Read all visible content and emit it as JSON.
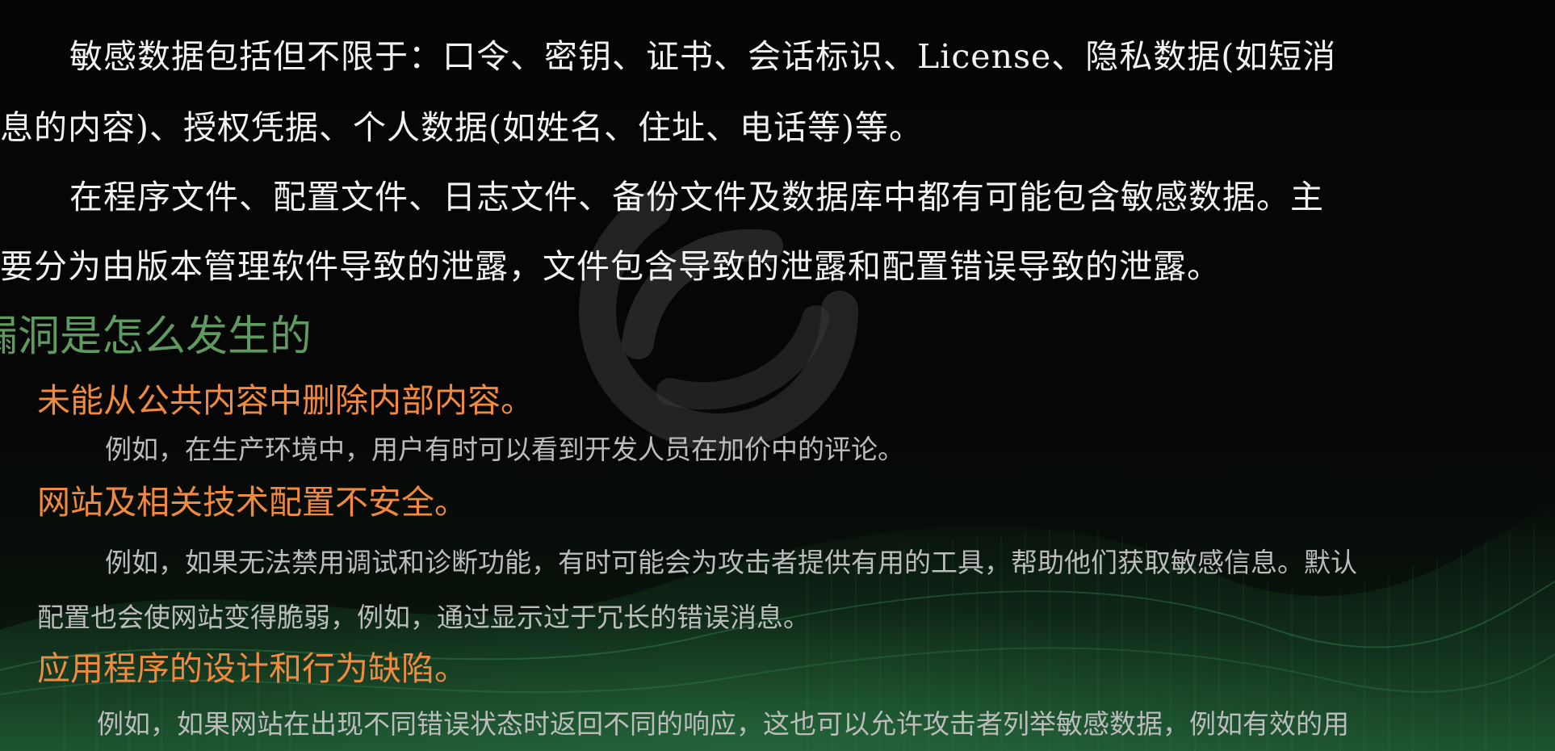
{
  "intro": {
    "p1_line1": "敏感数据包括但不限于：口令、密钥、证书、会话标识、License、隐私数据(如短消",
    "p1_line2": "息的内容)、授权凭据、个人数据(如姓名、住址、电话等)等。",
    "p2_line1": "在程序文件、配置文件、日志文件、备份文件及数据库中都有可能包含敏感数据。主",
    "p2_line2": "要分为由版本管理软件导致的泄露，文件包含导致的泄露和配置错误导致的泄露。"
  },
  "section_title": "漏洞是怎么发生的",
  "causes": [
    {
      "title": "未能从公共内容中删除内部内容。",
      "example_line1": "例如，在生产环境中，用户有时可以看到开发人员在加价中的评论。"
    },
    {
      "title": "网站及相关技术配置不安全。",
      "example_line1": "例如，如果无法禁用调试和诊断功能，有时可能会为攻击者提供有用的工具，帮助他们获取敏感信息。默认",
      "example_line2": "配置也会使网站变得脆弱，例如，通过显示过于冗长的错误消息。"
    },
    {
      "title": "应用程序的设计和行为缺陷。",
      "example_line1": "例如，如果网站在出现不同错误状态时返回不同的响应，这也可以允许攻击者列举敏感数据，例如有效的用"
    }
  ],
  "colors": {
    "background": "#040404",
    "body_text": "#f2f2f2",
    "section_heading": "#5f9a5e",
    "cause_heading": "#f08a40",
    "example_text": "#bcbcbc",
    "glow": "#2e8a4a"
  },
  "icons": {
    "watermark": "circular-swirl-logo-watermark",
    "background": "green-particle-wave"
  }
}
